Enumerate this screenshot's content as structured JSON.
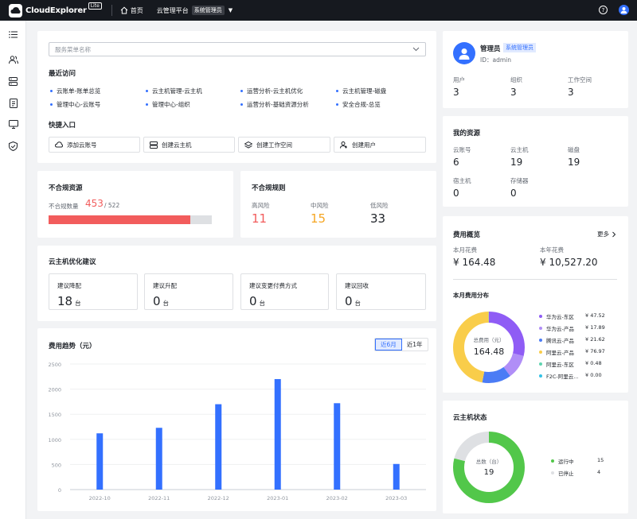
{
  "header": {
    "logo_text": "CloudExplorer",
    "logo_badge": "Lite",
    "home": "首页",
    "platform": "云管理平台",
    "role": "系统管理员"
  },
  "search": {
    "placeholder": "服务菜单名称"
  },
  "recent": {
    "title": "最近访问",
    "items": [
      "云账单-账单总览",
      "云主机管理-云主机",
      "运营分析-云主机优化",
      "云主机管理-磁盘",
      "管理中心-云账号",
      "管理中心-组织",
      "运营分析-基础资源分析",
      "安全合规-总览"
    ]
  },
  "quick": {
    "title": "快捷入口",
    "items": [
      "添加云账号",
      "创建云主机",
      "创建工作空间",
      "创建用户"
    ]
  },
  "noncompliant": {
    "title": "不合规资源",
    "label": "不合规数量",
    "count": "453",
    "total": "/ 522",
    "ratio": 0.868
  },
  "rules": {
    "title": "不合规规则",
    "high_label": "高风险",
    "high": "11",
    "mid_label": "中风险",
    "mid": "15",
    "low_label": "低风险",
    "low": "33"
  },
  "optimize": {
    "title": "云主机优化建议",
    "unit": "台",
    "items": [
      {
        "label": "建议降配",
        "value": "18"
      },
      {
        "label": "建议升配",
        "value": "0"
      },
      {
        "label": "建议变更付费方式",
        "value": "0"
      },
      {
        "label": "建议回收",
        "value": "0"
      }
    ]
  },
  "trend": {
    "title": "费用趋势（元）",
    "tab_6m": "近6月",
    "tab_1y": "近1年"
  },
  "chart_data": {
    "type": "bar",
    "categories": [
      "2022-10",
      "2022-11",
      "2022-12",
      "2023-01",
      "2023-02",
      "2023-03"
    ],
    "values": [
      1120,
      1230,
      1700,
      2200,
      1720,
      510
    ],
    "yticks": [
      "0",
      "500",
      "1000",
      "1500",
      "2000",
      "2500"
    ],
    "ylim": [
      0,
      2500
    ],
    "color": "#3370ff"
  },
  "user": {
    "name": "管理员",
    "role": "系统管理员",
    "id": "ID：admin",
    "stats": [
      {
        "label": "用户",
        "value": "3"
      },
      {
        "label": "组织",
        "value": "3"
      },
      {
        "label": "工作空间",
        "value": "3"
      }
    ]
  },
  "resources": {
    "title": "我的资源",
    "items": [
      {
        "label": "云账号",
        "value": "6"
      },
      {
        "label": "云主机",
        "value": "19"
      },
      {
        "label": "磁盘",
        "value": "19"
      },
      {
        "label": "宿主机",
        "value": "0"
      },
      {
        "label": "存储器",
        "value": "0"
      }
    ]
  },
  "cost": {
    "title": "费用概览",
    "more": "更多",
    "month_label": "本月花费",
    "month_value": "¥ 164.48",
    "year_label": "本年花费",
    "year_value": "¥ 10,527.20",
    "dist_title": "本月费用分布",
    "center_label": "总费用（元）",
    "center_value": "164.48",
    "legend": [
      {
        "name": "华为云-东区",
        "value": "¥ 47.52",
        "amount": 47.52,
        "color": "#8f5cf5"
      },
      {
        "name": "华为云-产品",
        "value": "¥ 17.89",
        "amount": 17.89,
        "color": "#b08ef7"
      },
      {
        "name": "腾讯云-产品",
        "value": "¥ 21.62",
        "amount": 21.62,
        "color": "#4b7cf5"
      },
      {
        "name": "阿里云-产品",
        "value": "¥ 76.97",
        "amount": 76.97,
        "color": "#f9cd4a"
      },
      {
        "name": "阿里云-东区",
        "value": "¥ 0.48",
        "amount": 0.48,
        "color": "#5fd4b0"
      },
      {
        "name": "F2C-阿里云...",
        "value": "¥ 0.00",
        "amount": 0.0,
        "color": "#33c2e6"
      }
    ]
  },
  "vmstatus": {
    "title": "云主机状态",
    "center_label": "总数（台）",
    "center_value": "19",
    "legend": [
      {
        "name": "运行中",
        "value": "15",
        "count": 15,
        "color": "#52c74a"
      },
      {
        "name": "已停止",
        "value": "4",
        "count": 4,
        "color": "#dee0e3"
      }
    ]
  }
}
